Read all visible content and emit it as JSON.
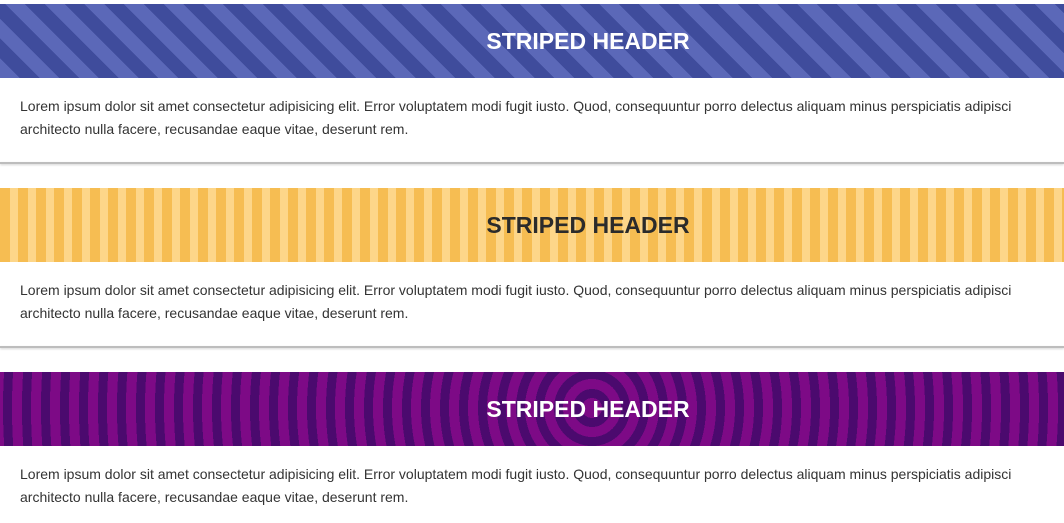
{
  "cards": [
    {
      "title": "STRIPED HEADER",
      "body_lines": [
        "Lorem ipsum dolor sit amet consectetur adipisicing elit. Error voluptatem modi fugit iusto. Quod, consequuntur porro delectus aliquam minus perspiciatis adipisci",
        "architecto nulla facere, recusandae eaque vitae, deserunt rem."
      ],
      "stripe_colors": [
        "#5b68b8",
        "#3f4c9c"
      ],
      "title_color": "#ffffff"
    },
    {
      "title": "STRIPED HEADER",
      "body_lines": [
        "Lorem ipsum dolor sit amet consectetur adipisicing elit. Error voluptatem modi fugit iusto. Quod, consequuntur porro delectus aliquam minus perspiciatis adipisci",
        "architecto nulla facere, recusandae eaque vitae, deserunt rem."
      ],
      "stripe_colors": [
        "#f6bd52",
        "#fdd689"
      ],
      "title_color": "#2b2b2b"
    },
    {
      "title": "STRIPED HEADER",
      "body_lines": [
        "Lorem ipsum dolor sit amet consectetur adipisicing elit. Error voluptatem modi fugit iusto. Quod, consequuntur porro delectus aliquam minus perspiciatis adipisci",
        "architecto nulla facere, recusandae eaque vitae, deserunt rem."
      ],
      "stripe_colors": [
        "#7d0a86",
        "#4b0a6e"
      ],
      "title_color": "#ffffff"
    }
  ]
}
